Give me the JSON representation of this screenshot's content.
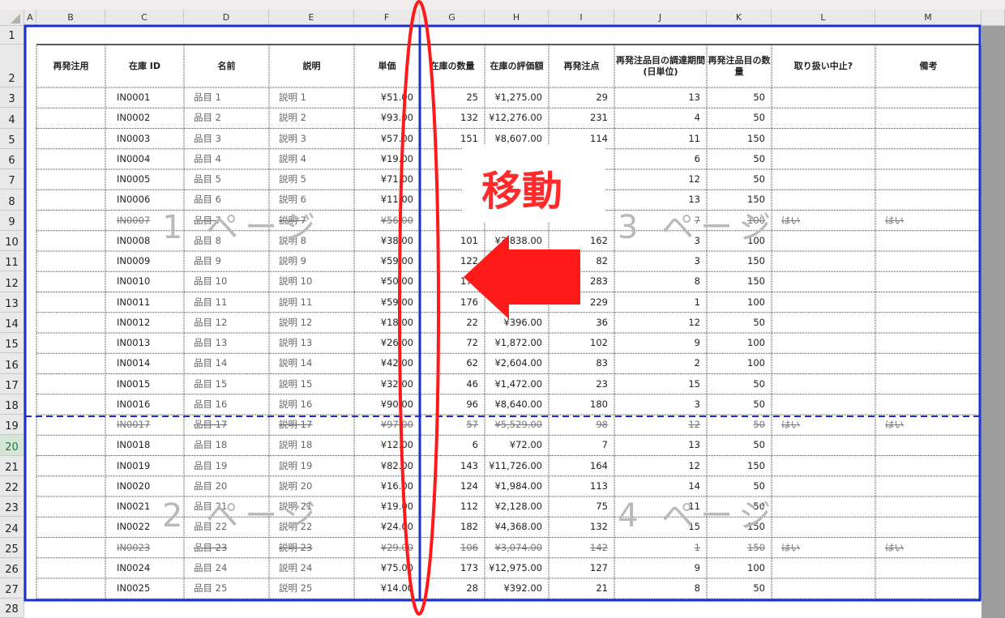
{
  "columns": [
    "A",
    "B",
    "C",
    "D",
    "E",
    "F",
    "G",
    "H",
    "I",
    "J",
    "K",
    "L",
    "M"
  ],
  "rows": [
    "1",
    "2",
    "3",
    "4",
    "5",
    "6",
    "7",
    "8",
    "9",
    "10",
    "11",
    "12",
    "13",
    "14",
    "15",
    "16",
    "17",
    "18",
    "19",
    "20",
    "21",
    "22",
    "23",
    "24",
    "25",
    "26",
    "27",
    "28"
  ],
  "selected_row": "20",
  "headers": {
    "B": "再発注用",
    "C": "在庫 ID",
    "D": "名前",
    "E": "説明",
    "F": "単価",
    "G": "在庫の数量",
    "H": "在庫の評価額",
    "I": "再発注点",
    "J": "再発注品目の調達期間 (日単位)",
    "K": "再発注品目の数量",
    "L": "取り扱い中止?",
    "M": "備考"
  },
  "table_rows": [
    {
      "id": "IN0001",
      "name": "品目 1",
      "desc": "説明 1",
      "price": "¥51.00",
      "qty": "25",
      "value": "¥1,275.00",
      "reorder": "29",
      "days": "13",
      "reqty": "50",
      "disc": "",
      "note": "",
      "strike": false
    },
    {
      "id": "IN0002",
      "name": "品目 2",
      "desc": "説明 2",
      "price": "¥93.00",
      "qty": "132",
      "value": "¥12,276.00",
      "reorder": "231",
      "days": "4",
      "reqty": "50",
      "disc": "",
      "note": "",
      "strike": false
    },
    {
      "id": "IN0003",
      "name": "品目 3",
      "desc": "説明 3",
      "price": "¥57.00",
      "qty": "151",
      "value": "¥8,607.00",
      "reorder": "114",
      "days": "11",
      "reqty": "150",
      "disc": "",
      "note": "",
      "strike": false
    },
    {
      "id": "IN0004",
      "name": "品目 4",
      "desc": "説明 4",
      "price": "¥19.00",
      "qty": "1",
      "value": "",
      "reorder": "",
      "days": "6",
      "reqty": "50",
      "disc": "",
      "note": "",
      "strike": false
    },
    {
      "id": "IN0005",
      "name": "品目 5",
      "desc": "説明 5",
      "price": "¥71.00",
      "qty": "",
      "value": "",
      "reorder": "",
      "days": "12",
      "reqty": "50",
      "disc": "",
      "note": "",
      "strike": false
    },
    {
      "id": "IN0006",
      "name": "品目 6",
      "desc": "説明 6",
      "price": "¥11.00",
      "qty": "",
      "value": "",
      "reorder": "",
      "days": "13",
      "reqty": "150",
      "disc": "",
      "note": "",
      "strike": false
    },
    {
      "id": "IN0007",
      "name": "品目 7",
      "desc": "説明 7",
      "price": "¥56.00",
      "qty": "",
      "value": "",
      "reorder": "",
      "days": "7",
      "reqty": "100",
      "disc": "はい",
      "note": "はい",
      "strike": true
    },
    {
      "id": "IN0008",
      "name": "品目 8",
      "desc": "説明 8",
      "price": "¥38.00",
      "qty": "101",
      "value": "¥3,838.00",
      "reorder": "162",
      "days": "3",
      "reqty": "100",
      "disc": "",
      "note": "",
      "strike": false
    },
    {
      "id": "IN0009",
      "name": "品目 9",
      "desc": "説明 9",
      "price": "¥59.00",
      "qty": "122",
      "value": "",
      "reorder": "82",
      "days": "3",
      "reqty": "150",
      "disc": "",
      "note": "",
      "strike": false
    },
    {
      "id": "IN0010",
      "name": "品目 10",
      "desc": "説明 10",
      "price": "¥50.00",
      "qty": "175",
      "value": "",
      "reorder": "283",
      "days": "8",
      "reqty": "150",
      "disc": "",
      "note": "",
      "strike": false
    },
    {
      "id": "IN0011",
      "name": "品目 11",
      "desc": "説明 11",
      "price": "¥59.00",
      "qty": "176",
      "value": "",
      "reorder": "229",
      "days": "1",
      "reqty": "100",
      "disc": "",
      "note": "",
      "strike": false
    },
    {
      "id": "IN0012",
      "name": "品目 12",
      "desc": "説明 12",
      "price": "¥18.00",
      "qty": "22",
      "value": "¥396.00",
      "reorder": "36",
      "days": "12",
      "reqty": "50",
      "disc": "",
      "note": "",
      "strike": false
    },
    {
      "id": "IN0013",
      "name": "品目 13",
      "desc": "説明 13",
      "price": "¥26.00",
      "qty": "72",
      "value": "¥1,872.00",
      "reorder": "102",
      "days": "9",
      "reqty": "100",
      "disc": "",
      "note": "",
      "strike": false
    },
    {
      "id": "IN0014",
      "name": "品目 14",
      "desc": "説明 14",
      "price": "¥42.00",
      "qty": "62",
      "value": "¥2,604.00",
      "reorder": "83",
      "days": "2",
      "reqty": "100",
      "disc": "",
      "note": "",
      "strike": false
    },
    {
      "id": "IN0015",
      "name": "品目 15",
      "desc": "説明 15",
      "price": "¥32.00",
      "qty": "46",
      "value": "¥1,472.00",
      "reorder": "23",
      "days": "15",
      "reqty": "50",
      "disc": "",
      "note": "",
      "strike": false
    },
    {
      "id": "IN0016",
      "name": "品目 16",
      "desc": "説明 16",
      "price": "¥90.00",
      "qty": "96",
      "value": "¥8,640.00",
      "reorder": "180",
      "days": "3",
      "reqty": "50",
      "disc": "",
      "note": "",
      "strike": false
    },
    {
      "id": "IN0017",
      "name": "品目 17",
      "desc": "説明 17",
      "price": "¥97.00",
      "qty": "57",
      "value": "¥5,529.00",
      "reorder": "98",
      "days": "12",
      "reqty": "50",
      "disc": "はい",
      "note": "はい",
      "strike": true
    },
    {
      "id": "IN0018",
      "name": "品目 18",
      "desc": "説明 18",
      "price": "¥12.00",
      "qty": "6",
      "value": "¥72.00",
      "reorder": "7",
      "days": "13",
      "reqty": "50",
      "disc": "",
      "note": "",
      "strike": false
    },
    {
      "id": "IN0019",
      "name": "品目 19",
      "desc": "説明 19",
      "price": "¥82.00",
      "qty": "143",
      "value": "¥11,726.00",
      "reorder": "164",
      "days": "12",
      "reqty": "150",
      "disc": "",
      "note": "",
      "strike": false
    },
    {
      "id": "IN0020",
      "name": "品目 20",
      "desc": "説明 20",
      "price": "¥16.00",
      "qty": "124",
      "value": "¥1,984.00",
      "reorder": "113",
      "days": "14",
      "reqty": "50",
      "disc": "",
      "note": "",
      "strike": false
    },
    {
      "id": "IN0021",
      "name": "品目 21",
      "desc": "説明 21",
      "price": "¥19.00",
      "qty": "112",
      "value": "¥2,128.00",
      "reorder": "75",
      "days": "11",
      "reqty": "50",
      "disc": "",
      "note": "",
      "strike": false
    },
    {
      "id": "IN0022",
      "name": "品目 22",
      "desc": "説明 22",
      "price": "¥24.00",
      "qty": "182",
      "value": "¥4,368.00",
      "reorder": "132",
      "days": "15",
      "reqty": "150",
      "disc": "",
      "note": "",
      "strike": false
    },
    {
      "id": "IN0023",
      "name": "品目 23",
      "desc": "説明 23",
      "price": "¥29.00",
      "qty": "106",
      "value": "¥3,074.00",
      "reorder": "142",
      "days": "1",
      "reqty": "150",
      "disc": "はい",
      "note": "はい",
      "strike": true
    },
    {
      "id": "IN0024",
      "name": "品目 24",
      "desc": "説明 24",
      "price": "¥75.00",
      "qty": "173",
      "value": "¥12,975.00",
      "reorder": "127",
      "days": "9",
      "reqty": "100",
      "disc": "",
      "note": "",
      "strike": false
    },
    {
      "id": "IN0025",
      "name": "品目 25",
      "desc": "説明 25",
      "price": "¥14.00",
      "qty": "28",
      "value": "¥392.00",
      "reorder": "21",
      "days": "8",
      "reqty": "50",
      "disc": "",
      "note": "",
      "strike": false
    }
  ],
  "page_labels": {
    "p1": "1 ページ",
    "p2": "2 ページ",
    "p3": "3 ページ",
    "p4": "4 ページ"
  },
  "annotation": {
    "move_label": "移動"
  },
  "colors": {
    "page_break": "#1a2fd0",
    "annotation": "#ff1a1a"
  }
}
